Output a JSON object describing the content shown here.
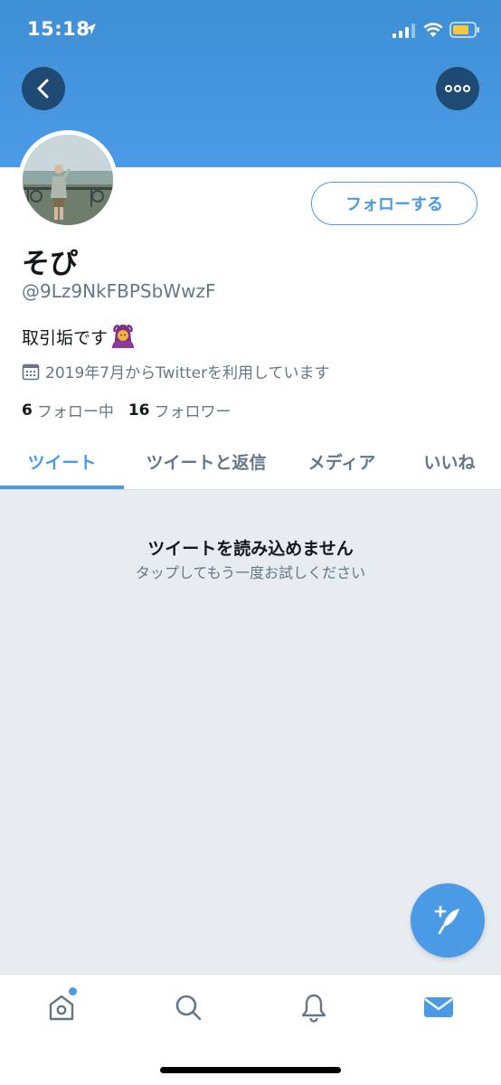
{
  "status_bar": {
    "time": "15:18"
  },
  "profile": {
    "display_name": "そぴ",
    "handle": "@9Lz9NkFBPSbWwzF",
    "bio": "取引垢です",
    "bio_emoji": "person-gesturing-ok-icon",
    "joined": "2019年7月からTwitterを利用しています",
    "following_count": "6",
    "following_label": "フォロー中",
    "followers_count": "16",
    "followers_label": "フォロワー"
  },
  "actions": {
    "follow_label": "フォローする"
  },
  "tabs": [
    {
      "label": "ツイート",
      "active": true
    },
    {
      "label": "ツイートと返信",
      "active": false
    },
    {
      "label": "メディア",
      "active": false
    },
    {
      "label": "いいね",
      "active": false
    }
  ],
  "content": {
    "error_title": "ツイートを読み込めません",
    "error_subtitle": "タップしてもう一度お試しください"
  },
  "bottom_nav": [
    "home-icon",
    "search-icon",
    "notifications-icon",
    "messages-icon"
  ],
  "colors": {
    "accent": "#4a9ae6",
    "banner": "#3f8fd6",
    "muted": "#657786",
    "background_gray": "#e6ecf0"
  }
}
